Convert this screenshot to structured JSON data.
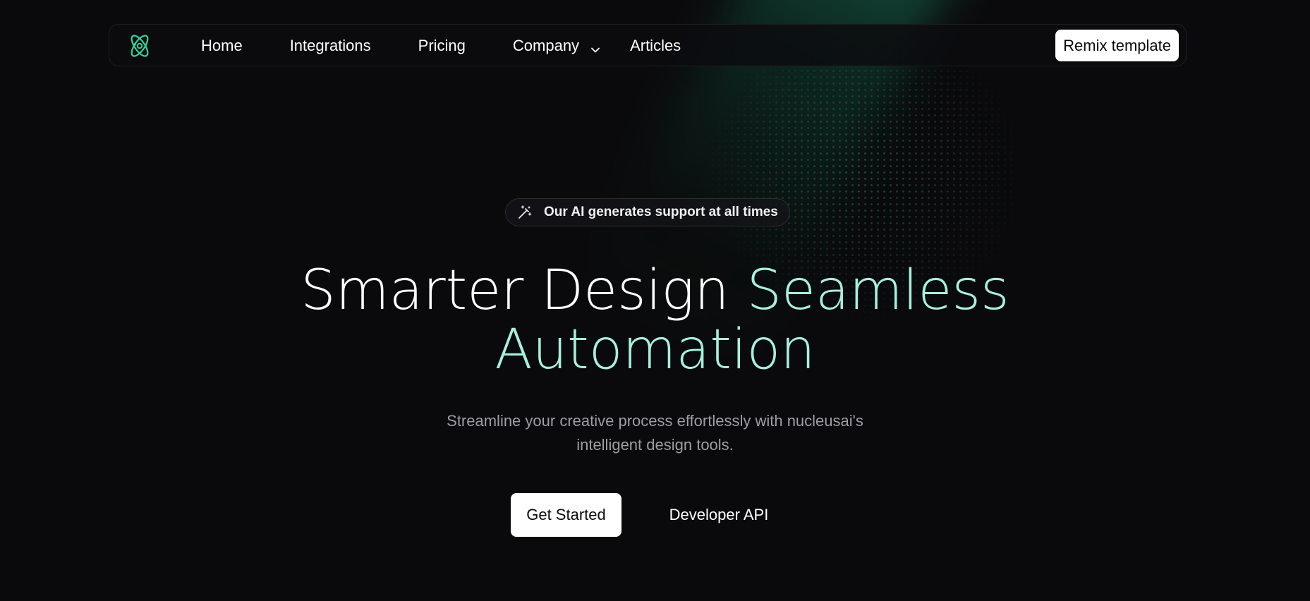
{
  "nav": {
    "links": [
      "Home",
      "Integrations",
      "Pricing",
      "Company",
      "Articles"
    ],
    "cta_label": "Remix template"
  },
  "hero": {
    "badge_text": "Our AI generates support at all times",
    "headline_white": "Smarter Design",
    "headline_accent_1": "Seamless",
    "headline_accent_2": "Automation",
    "subtitle_line1": "Streamline your creative process effortlessly with nucleusai's",
    "subtitle_line2": "intelligent design tools.",
    "primary_button": "Get Started",
    "secondary_button": "Developer API"
  },
  "colors": {
    "background": "#0a0a0c",
    "accent": "#a8f0dc",
    "brand_green": "#2fd49a"
  },
  "icons": {
    "logo": "atom-logo-icon",
    "company_dropdown": "chevron-down-icon",
    "badge": "magic-wand-icon"
  }
}
